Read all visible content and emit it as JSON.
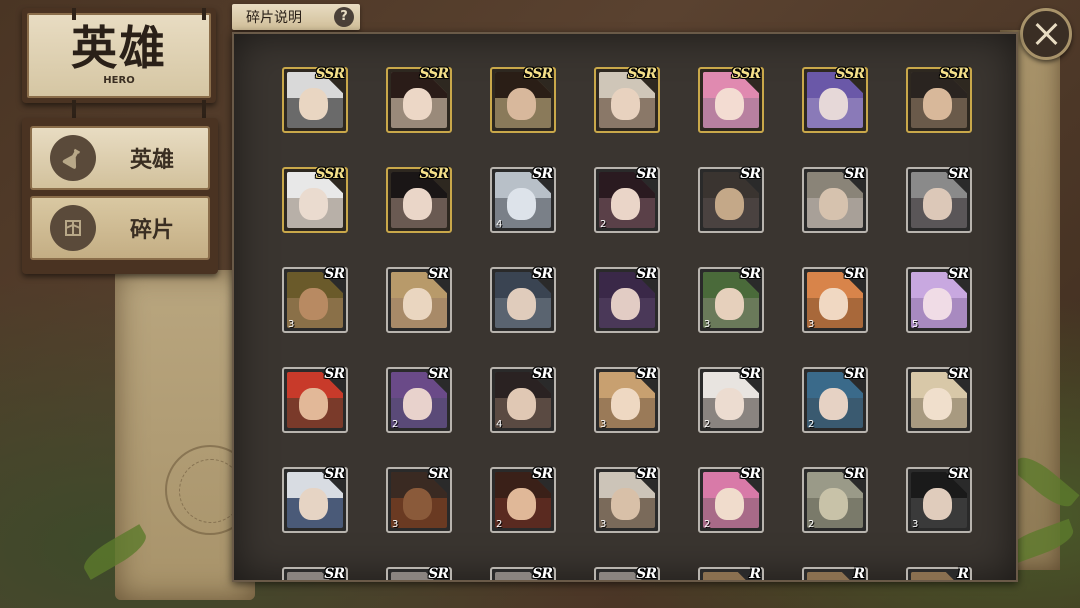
{
  "header": {
    "title_cn": "英雄",
    "title_en": "HERO",
    "help_label": "碎片说明",
    "help_icon": "?"
  },
  "side_menu": {
    "items": [
      {
        "label": "英雄",
        "icon": "potion-icon",
        "active": true
      },
      {
        "label": "碎片",
        "icon": "shard-icon",
        "active": false
      }
    ]
  },
  "colors": {
    "ssr_frame": "#c9a84a",
    "sr_frame": "#b8b4ae",
    "panel_bg": "#3a3530",
    "parchment": "#e8dcc2"
  },
  "cards": [
    {
      "rarity": "SSR",
      "count": "",
      "hair": "#d9d9d9",
      "skin": "#e9d6c2",
      "bg": "#6a6a6a"
    },
    {
      "rarity": "SSR",
      "count": "",
      "hair": "#2a1c18",
      "skin": "#ecd7c6",
      "bg": "#9a8a7a"
    },
    {
      "rarity": "SSR",
      "count": "",
      "hair": "#2a1e16",
      "skin": "#d8b89c",
      "bg": "#8a7a5a"
    },
    {
      "rarity": "SSR",
      "count": "",
      "hair": "#cfc6b8",
      "skin": "#e8d2bf",
      "bg": "#8a7868"
    },
    {
      "rarity": "SSR",
      "count": "",
      "hair": "#e08ab0",
      "skin": "#f3dcd2",
      "bg": "#b880a0"
    },
    {
      "rarity": "SSR",
      "count": "",
      "hair": "#6a58a8",
      "skin": "#e6d8d8",
      "bg": "#8a7ab8"
    },
    {
      "rarity": "SSR",
      "count": "",
      "hair": "#2a2420",
      "skin": "#d8b89a",
      "bg": "#6a5a4a"
    },
    {
      "rarity": "SSR",
      "count": "",
      "hair": "#e8e8e8",
      "skin": "#eadbcf",
      "bg": "#b8b0a8"
    },
    {
      "rarity": "SSR",
      "count": "",
      "hair": "#1a1616",
      "skin": "#ead6c8",
      "bg": "#6a5a52"
    },
    {
      "rarity": "SR",
      "count": "4",
      "hair": "#b8c0c8",
      "skin": "#dde3ea",
      "bg": "#7a8088"
    },
    {
      "rarity": "SR",
      "count": "2",
      "hair": "#2a1a20",
      "skin": "#ead5c8",
      "bg": "#5a4048"
    },
    {
      "rarity": "SR",
      "count": "",
      "hair": "#3a3430",
      "skin": "#c4a888",
      "bg": "#4a4240"
    },
    {
      "rarity": "SR",
      "count": "",
      "hair": "#8a8478",
      "skin": "#d6c2ae",
      "bg": "#a8a098"
    },
    {
      "rarity": "SR",
      "count": "",
      "hair": "#8a8a8a",
      "skin": "#dcc8b8",
      "bg": "#5a5658"
    },
    {
      "rarity": "SR",
      "count": "3",
      "hair": "#6a5a2a",
      "skin": "#b88a62",
      "bg": "#8a7048"
    },
    {
      "rarity": "SR",
      "count": "",
      "hair": "#b89a6a",
      "skin": "#ead6c0",
      "bg": "#a88a68"
    },
    {
      "rarity": "SR",
      "count": "",
      "hair": "#3a4452",
      "skin": "#e0ccbc",
      "bg": "#5a6470"
    },
    {
      "rarity": "SR",
      "count": "",
      "hair": "#3a2848",
      "skin": "#e2ccc4",
      "bg": "#4a3858"
    },
    {
      "rarity": "SR",
      "count": "3",
      "hair": "#4a6a3a",
      "skin": "#e6d0bc",
      "bg": "#6a7a5a"
    },
    {
      "rarity": "SR",
      "count": "3",
      "hair": "#d8844a",
      "skin": "#f0d8c2",
      "bg": "#a8683a"
    },
    {
      "rarity": "SR",
      "count": "5",
      "hair": "#c8a8e0",
      "skin": "#f0dce6",
      "bg": "#a88ac0"
    },
    {
      "rarity": "SR",
      "count": "",
      "hair": "#c83a2a",
      "skin": "#e2b898",
      "bg": "#7a3a2a"
    },
    {
      "rarity": "SR",
      "count": "2",
      "hair": "#6a4a88",
      "skin": "#e8d2cc",
      "bg": "#5a4a78"
    },
    {
      "rarity": "SR",
      "count": "4",
      "hair": "#2a2222",
      "skin": "#e0c8b4",
      "bg": "#5a4a42"
    },
    {
      "rarity": "SR",
      "count": "3",
      "hair": "#c8a070",
      "skin": "#eed8c2",
      "bg": "#9a7a58"
    },
    {
      "rarity": "SR",
      "count": "2",
      "hair": "#e8e4e0",
      "skin": "#ecdcd0",
      "bg": "#8a8480"
    },
    {
      "rarity": "SR",
      "count": "2",
      "hair": "#3a6a8a",
      "skin": "#e6d2c4",
      "bg": "#3a5a70"
    },
    {
      "rarity": "SR",
      "count": "",
      "hair": "#d8c8a8",
      "skin": "#f0dfcc",
      "bg": "#a89a80"
    },
    {
      "rarity": "SR",
      "count": "",
      "hair": "#d8dce2",
      "skin": "#e6d4c4",
      "bg": "#4a5a78"
    },
    {
      "rarity": "SR",
      "count": "3",
      "hair": "#3a2a22",
      "skin": "#8a5a3a",
      "bg": "#6a3a22"
    },
    {
      "rarity": "SR",
      "count": "2",
      "hair": "#3a2018",
      "skin": "#e0b898",
      "bg": "#5a2a20"
    },
    {
      "rarity": "SR",
      "count": "3",
      "hair": "#ccc4b8",
      "skin": "#d8c0a8",
      "bg": "#7a6a5a"
    },
    {
      "rarity": "SR",
      "count": "2",
      "hair": "#d87aa8",
      "skin": "#f0dccc",
      "bg": "#a86a88"
    },
    {
      "rarity": "SR",
      "count": "2",
      "hair": "#9a9a88",
      "skin": "#c8c2a8",
      "bg": "#7a7a6a"
    },
    {
      "rarity": "SR",
      "count": "3",
      "hair": "#1a1a1a",
      "skin": "#e0ccbc",
      "bg": "#3a3a3a"
    },
    {
      "rarity": "SR",
      "count": "",
      "hair": "#8a8480",
      "skin": "#d8c8b8",
      "bg": "#6a6460"
    },
    {
      "rarity": "SR",
      "count": "",
      "hair": "#8a8480",
      "skin": "#d8c8b8",
      "bg": "#6a6460"
    },
    {
      "rarity": "SR",
      "count": "",
      "hair": "#8a8480",
      "skin": "#d8c8b8",
      "bg": "#6a6460"
    },
    {
      "rarity": "SR",
      "count": "",
      "hair": "#8a8480",
      "skin": "#d8c8b8",
      "bg": "#6a6460"
    },
    {
      "rarity": "R",
      "count": "",
      "hair": "#8a7050",
      "skin": "#d8c0a0",
      "bg": "#6a5a42"
    },
    {
      "rarity": "R",
      "count": "",
      "hair": "#8a7050",
      "skin": "#d8c0a0",
      "bg": "#6a5a42"
    },
    {
      "rarity": "R",
      "count": "",
      "hair": "#8a7050",
      "skin": "#d8c0a0",
      "bg": "#6a5a42"
    }
  ]
}
